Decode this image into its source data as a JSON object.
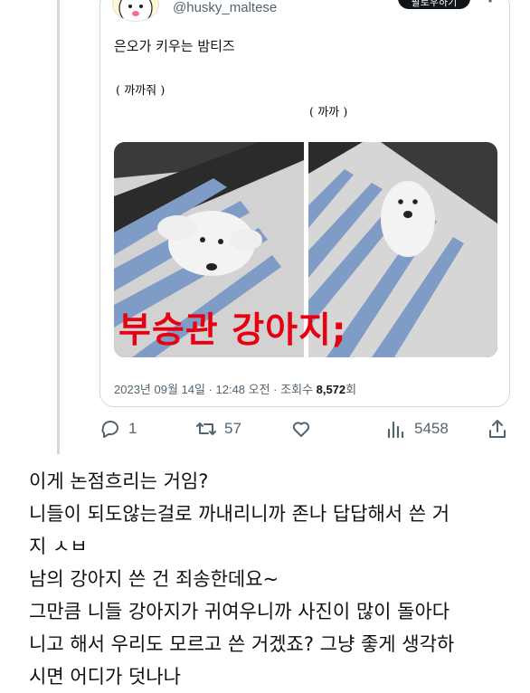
{
  "tweet": {
    "handle": "@husky_maltese",
    "follow_label": "팔로우하기",
    "caption_line1": "은오가 키우는 밤티즈",
    "caption_line2": "( 까까줘 )",
    "caption_line3": "( 까까 )",
    "image_overlay_text": "부승관 강아지;",
    "timestamp_prefix": "2023년 09월 14일 · 12:48 오전 · 조회수 ",
    "view_count": "8,572",
    "view_suffix": "회"
  },
  "actions": {
    "reply_count": "1",
    "retweet_count": "57",
    "like_count": "",
    "views_count": "5458"
  },
  "comment": {
    "lines": [
      "이게 논점흐리는 거임?",
      "니들이 되도않는걸로 까내리니까 존나 답답해서 쓴 거",
      "지 ㅅㅂ",
      "남의 강아지 쓴 건 죄송한데요~",
      "그만큼 니들 강아지가 귀여우니까 사진이 많이 돌아다",
      "니고 해서 우리도 모르고 쓴 거겠죠? 그냥 좋게 생각하",
      "시면 어디가 덧나나"
    ]
  },
  "colors": {
    "overlay_red": "#e60012",
    "secondary_text": "#536471",
    "border": "#cfd9de"
  },
  "icons": [
    "reply-icon",
    "retweet-icon",
    "heart-icon",
    "views-icon",
    "share-icon",
    "more-icon"
  ]
}
